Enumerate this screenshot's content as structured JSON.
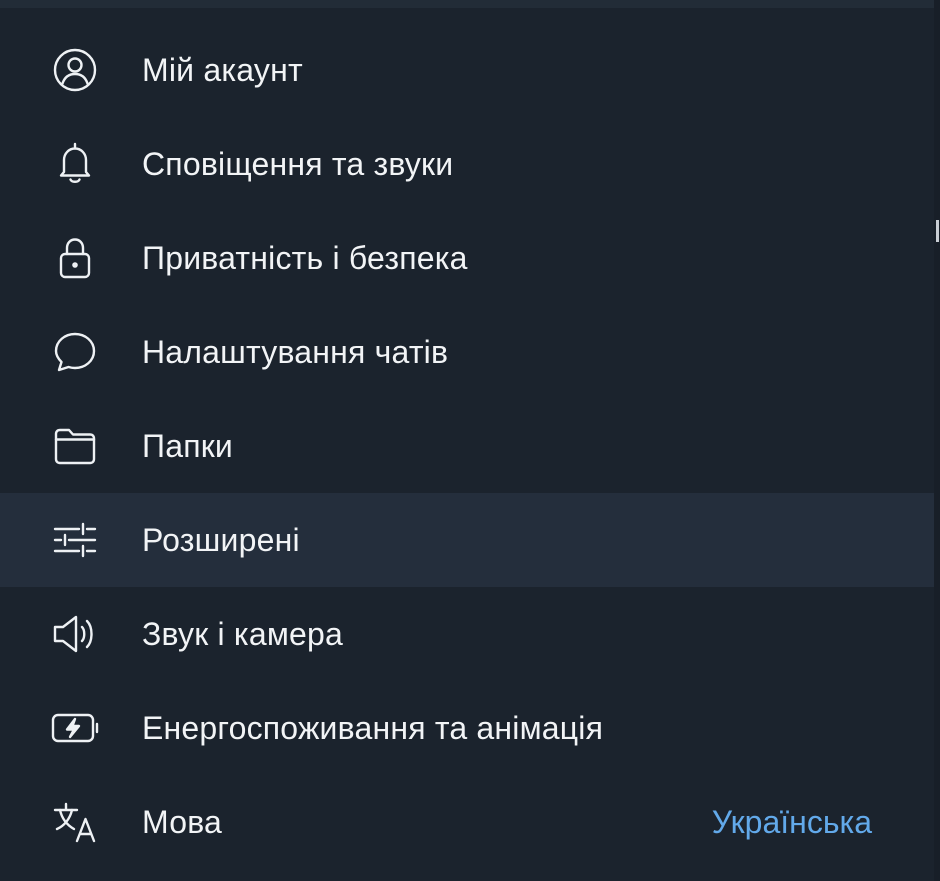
{
  "settings_menu": {
    "items": [
      {
        "label": "Мій акаунт",
        "icon": "user-circle-icon"
      },
      {
        "label": "Сповіщення та звуки",
        "icon": "bell-icon"
      },
      {
        "label": "Приватність і безпека",
        "icon": "lock-icon"
      },
      {
        "label": "Налаштування чатів",
        "icon": "chat-bubble-icon"
      },
      {
        "label": "Папки",
        "icon": "folder-icon"
      },
      {
        "label": "Розширені",
        "icon": "sliders-icon",
        "highlighted": true
      },
      {
        "label": "Звук і камера",
        "icon": "speaker-icon"
      },
      {
        "label": "Енергоспоживання та анімація",
        "icon": "battery-bolt-icon"
      },
      {
        "label": "Мова",
        "icon": "translate-icon",
        "value": "Українська"
      }
    ]
  },
  "colors": {
    "background": "#1b232d",
    "highlight_row": "#242e3c",
    "text": "#f2f4f6",
    "accent_value": "#62a9ea"
  }
}
